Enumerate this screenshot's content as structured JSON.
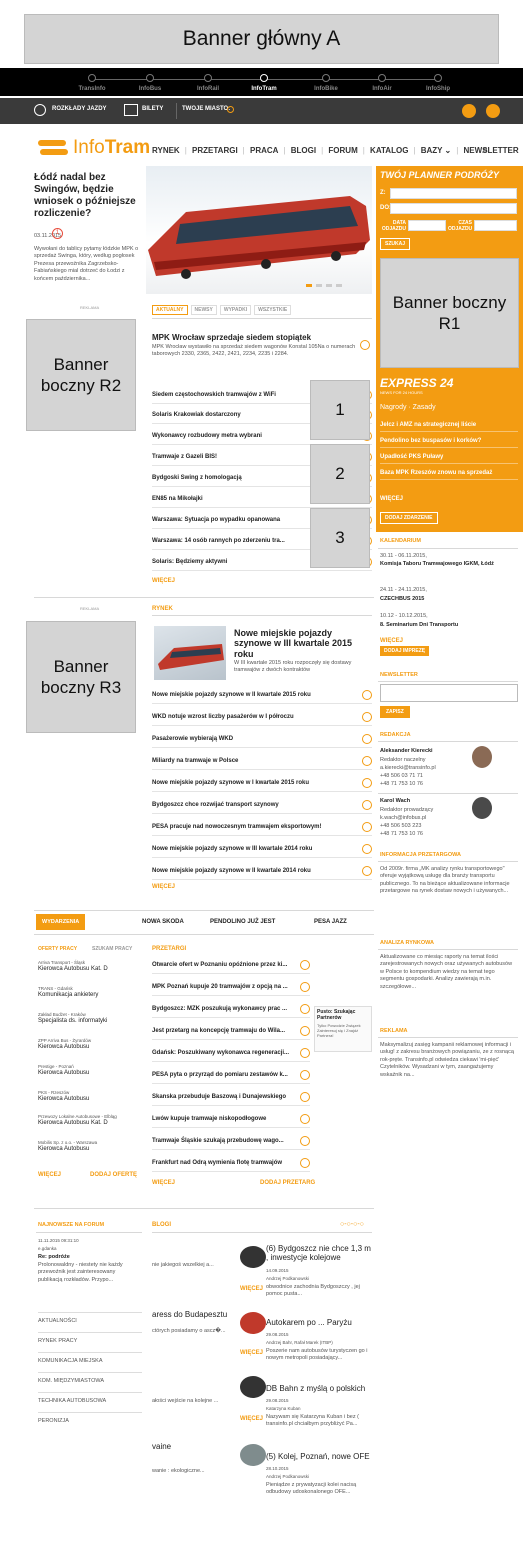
{
  "top_banner": {
    "label": "Banner główny A"
  },
  "portals": [
    {
      "label": "TransInfo",
      "active": false
    },
    {
      "label": "InfoBus",
      "active": false
    },
    {
      "label": "InfoRail",
      "active": false
    },
    {
      "label": "InfoTram",
      "active": true
    },
    {
      "label": "InfoBike",
      "active": false
    },
    {
      "label": "InfoAir",
      "active": false
    },
    {
      "label": "InfoShip",
      "active": false
    }
  ],
  "toolbar": {
    "timetables": "ROZKŁADY JAZDY",
    "tickets": "BILETY",
    "your_city": "TWOJE MIASTO:"
  },
  "logo": {
    "part1": "Info",
    "part2": "Tram"
  },
  "nav": [
    "RYNEK",
    "PRZETARGI",
    "PRACA",
    "BLOGI",
    "FORUM",
    "KATALOG",
    "BAZY",
    "NEWSLETTER"
  ],
  "hero": {
    "title": "Łódź nadal bez Swingów, będzie wniosek o późniejsze rozliczenie?",
    "date": "03.11.2015",
    "comments": "1",
    "excerpt": "Wywołani do tablicy pytamy łódzkie MPK o sprzedaż Swinga, który, według pogłosek Prezesa przewoźnika Zagrzebsko-Fabiańskiego mial dotrzeć do Łodzi z końcem października..."
  },
  "planner": {
    "title": "TWÓJ PLANNER PODRÓŻY",
    "from": "Z:",
    "to": "DO:",
    "date_label": "DATA ODJAZDU",
    "time_label": "CZAS ODJAZDU",
    "search": "SZUKAJ"
  },
  "banner_r1": "Banner boczny R1",
  "banner_r2": "Banner boczny R2",
  "banner_r3": "Banner boczny R3",
  "express": {
    "title": "EXPRESS 24",
    "subtitle": "NEWS FOR 24 HOURS",
    "rules": "Nagrody · Zasady",
    "items": [
      "Jelcz i AMZ na strategicznej liście",
      "Pendolino bez buspasów i korków?",
      "Upadłość PKS Puławy",
      "Baza MPK Rzeszów znowu na sprzedaż"
    ],
    "more": "WIĘCEJ",
    "add": "DODAJ ZDARZENIE"
  },
  "ad_label_1": "REKLAMA",
  "tabs": [
    "AKTUALNY",
    "NEWSY",
    "WYPADKI",
    "WSZYSTKIE"
  ],
  "lead": {
    "title": "MPK Wrocław sprzedaje siedem stopiątek",
    "text": "MPK Wrocław wystawiło na sprzedaż siedem wagonów Konstal 105Na o numerach taborowych 2330, 2365, 2422, 2421, 2234, 2235 i 2284."
  },
  "news": [
    "Siedem częstochowskich tramwajów z WiFi",
    "Solaris Krakowiak dostarczony",
    "Wykonawcy rozbudowy metra wybrani",
    "Tramwaje z Gazeli BIS!",
    "Bydgoski Swing z homologacją",
    "EN85 na Mikołajki",
    "Warszawa: Sytuacja po wypadku opanowana",
    "Warszawa: 14 osób rannych po zderzeniu tra...",
    "Solaris: Będziemy aktywni"
  ],
  "news_more": "WIĘCEJ",
  "numbered": [
    "1",
    "2",
    "3"
  ],
  "calendar": {
    "title": "KALENDARIUM",
    "events": [
      {
        "date": "30.11 - 06.11.2015,",
        "name": "Komisja Taboru Tramwajowego IGKM, Łódź"
      },
      {
        "date": "24.11 - 24.11.2015,",
        "name": "CZECHBUS 2015"
      },
      {
        "date": "10.12 - 10.12.2015,",
        "name": "8. Seminarium Dni Transportu"
      }
    ],
    "more": "WIĘCEJ",
    "add": "DODAJ IMPREZĘ"
  },
  "ad_label_2": "REKLAMA",
  "market": {
    "label": "RYNEK",
    "lead_title": "Nowe miejskie pojazdy szynowe w III kwartale 2015 roku",
    "lead_text": "W III kwartale 2015 roku rozpoczęły się dostawy tramwajów z dwóch kontraktów",
    "items": [
      "Nowe miejskie pojazdy szynowe w II kwartale 2015 roku",
      "WKD notuje wzrost liczby pasażerów w I półroczu",
      "Pasażerowie wybierają WKD",
      "Miliardy na tramwaje w Polsce",
      "Nowe miejskie pojazdy szynowe w I kwartale 2015 roku",
      "Bydgoszcz chce rozwijać transport szynowy",
      "PESA pracuje nad nowoczesnym tramwajem eksportowym!",
      "Nowe miejskie pojazdy szynowe w III kwartale 2014 roku",
      "Nowe miejskie pojazdy szynowe w II kwartale 2014 roku"
    ],
    "more": "WIĘCEJ"
  },
  "newsletter": {
    "title": "NEWSLETTER",
    "button": "ZAPISZ"
  },
  "editorial": {
    "title": "REDAKCJA",
    "people": [
      {
        "name": "Aleksander Kierecki",
        "role": "Redaktor naczelny",
        "email": "a.kierecki@transinfo.pl",
        "phone1": "+48 506 03 71 71",
        "phone2": "+48 71 753 10 76"
      },
      {
        "name": "Karol Wach",
        "role": "Redaktor prowadzący",
        "email": "k.wach@infobus.pl",
        "phone1": "+48 506 503 223",
        "phone2": "+48 71 753 10 76"
      }
    ]
  },
  "events_tabs": {
    "label": "WYDARZENIA",
    "items": [
      "NOWA SKODA",
      "PENDOLINO JUŻ JEST",
      "PESA JAZZ"
    ]
  },
  "tender_info": {
    "title": "INFORMACJA PRZETARGOWA",
    "text": "Od 2009r. firma „MK analizy rynku transportowego\" oferuje wyjątkową usługę dla branży transportu publicznego. To na bieżące aktualizowane informacje przetargowe na rynek dostaw nowych i używanych..."
  },
  "jobs": {
    "tabs": [
      "OFERTY PRACY",
      "SZUKAM PRACY"
    ],
    "items": [
      {
        "company": "Arriva Transport - Śląsk",
        "title": "Kierowca Autobusu Kat. D"
      },
      {
        "company": "TRANS - Gdańsk",
        "title": "Komunikacja ankietery"
      },
      {
        "company": "Zakład Budżet - Kraków",
        "title": "Specjalista ds. informatyki"
      },
      {
        "company": "ZPP Arriva Bus - Żyrardów",
        "title": "Kierowca Autobusu"
      },
      {
        "company": "Prestige - Poznań",
        "title": "Kierowca Autobusu"
      },
      {
        "company": "PKS - Rzeszów",
        "title": "Kierowca Autobusu"
      },
      {
        "company": "Przewozy Lokalne Autobusowe - Elbląg",
        "title": "Kierowca Autobusu Kat. D"
      },
      {
        "company": "Mobilis Sp. z o.o. - Warszawa",
        "title": "Kierowca Autobusu"
      }
    ],
    "more": "WIĘCEJ",
    "add": "DODAJ OFERTĘ"
  },
  "tenders": {
    "label": "PRZETARGI",
    "items": [
      "Otwarcie ofert w Poznaniu opóźnione przez ki...",
      "MPK Poznań kupuje 20 tramwajów z opcją na ...",
      "Bydgoszcz: MZK poszukują wykonawcy prac ...",
      "Jest przetarg na koncepcję tramwaju do Wila...",
      "Gdańsk: Poszukiwany wykonawca regeneracji...",
      "PESA pyta o przyrząd do pomiaru zestawów k...",
      "Skanska przebuduje Baszową i Dunajewskiego",
      "Lwów kupuje tramwaje niskopodłogowe",
      "Tramwaje Śląskie szukają przebudowę wago...",
      "Frankfurt nad Odrą wymienia flotę tramwajów"
    ],
    "more": "WIĘCEJ",
    "add": "DODAJ PRZETARG"
  },
  "partner_ad": {
    "title": "Pusto: Szukając Partnerów",
    "text": "Tylko Powodzie Związek Zainteresuj się i Znajdź Partnera!"
  },
  "market_analysis": {
    "title": "ANALIZA RYNKOWA",
    "text": "Aktualizowane co miesiąc raporty na temat ilości zarejestrowanych nowych oraz używanych autobusów w Polsce to kompendium wiedzy na temat tego segmentu gospodarki. Analizy zawierają m.in. szczegółowe..."
  },
  "advert": {
    "title": "REKLAMA",
    "text": "Maksymalizuj zasięg kampanii reklamowej informacji i usług! z zakresu branżowych powiązaniu, ze z rosnącą rok-pręte. Transinfo.pl odwiedza ciekawi 'mi-pięć' Czytelników. Wysadzani w tym, zaangażujemy wskaźnik na..."
  },
  "forum": {
    "title": "NAJNOWSZE NA FORUM",
    "meta": "11.11.2015 09:31:10",
    "author": "e.gdanka",
    "topic": "Re: podróże",
    "text": "Prolonowaldny - niestety nie każdy przewoźnik jest zainteresowany publikacją rozkładów. Przypo...",
    "categories": [
      "AKTUALNOŚCI",
      "RYNEK PRACY",
      "KOMUNIKACJA MIEJSKA",
      "KOM. MIĘDZYMIASTOWA",
      "TECHNIKA AUTOBUSOWA",
      "PERONIZJA"
    ]
  },
  "blogs": {
    "label": "BLOGI",
    "left_snippets": [
      {
        "text": "nie jakiegoś wszelkiej a..."
      },
      {
        "title": "aress do Budapesztu",
        "text": "ctórych posiadamy o ascz�..."
      },
      {
        "text": "ałości wejście na kolejne ..."
      },
      {
        "title": "vaine",
        "text": "wanie : ekologiczne..."
      }
    ],
    "posts": [
      {
        "title": "(6) Bydgoszcz nie chce 1,3 m , inwestycje kolejowe",
        "date": "14.09.2015",
        "author": "Andrzej Podkanowski",
        "text": "obwodnice zachodnia Bydgoszczy , jej pomoc pusta..."
      },
      {
        "title": "Autokarem po ... Paryżu",
        "date": "29.08.2015",
        "author": "Andrzej Bahr, Rafał Marek (ITBP)",
        "text": "Poszerie nam autobusów turystyczen go i nowym metropoli posiadający..."
      },
      {
        "title": "DB Bahn z myślą o polskich",
        "date": "29.08.2015",
        "author": "Katarzyna Kuban",
        "text": "Nazywam się Katarzyna Kuban i bez ( transinfo.pl chciałbym przybliżyć Pa..."
      },
      {
        "title": "(5) Kolej, Poznań, nowe OFE",
        "date": "28.10.2015",
        "author": "Andrzej Podkanowski",
        "text": "Pieniądze z prywatyzacji kolei nacisą odbudowy udoskonalonego OFE..."
      }
    ],
    "more": "WIĘCEJ"
  }
}
